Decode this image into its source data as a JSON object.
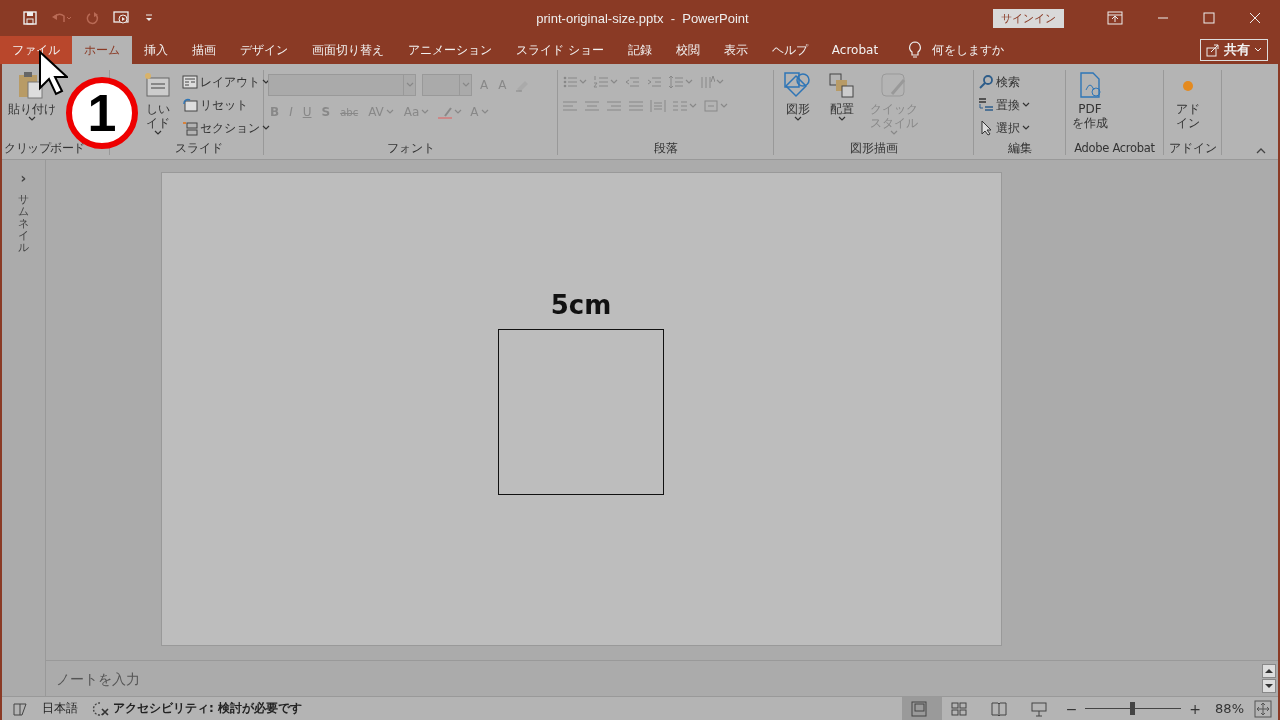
{
  "title_bar": {
    "title": "print-original-size.pptx  -  PowerPoint",
    "signin": "サインイン"
  },
  "tabs": [
    {
      "label": "ファイル",
      "kind": "file",
      "selected": false
    },
    {
      "label": "ホーム",
      "kind": "tab",
      "selected": true
    },
    {
      "label": "挿入",
      "kind": "tab",
      "selected": false
    },
    {
      "label": "描画",
      "kind": "tab",
      "selected": false
    },
    {
      "label": "デザイン",
      "kind": "tab",
      "selected": false
    },
    {
      "label": "画面切り替え",
      "kind": "tab",
      "selected": false
    },
    {
      "label": "アニメーション",
      "kind": "tab",
      "selected": false
    },
    {
      "label": "スライド ショー",
      "kind": "tab",
      "selected": false
    },
    {
      "label": "記録",
      "kind": "tab",
      "selected": false
    },
    {
      "label": "校閲",
      "kind": "tab",
      "selected": false
    },
    {
      "label": "表示",
      "kind": "tab",
      "selected": false
    },
    {
      "label": "ヘルプ",
      "kind": "tab",
      "selected": false
    },
    {
      "label": "Acrobat",
      "kind": "tab",
      "selected": false
    }
  ],
  "tell_me": "何をしますか",
  "share": "共有",
  "ribbon_groups": [
    {
      "label": "クリップボード",
      "kind": "columns",
      "disabled": false,
      "columns": [
        {
          "kind": "large",
          "lines": [
            "貼り付け"
          ],
          "caret": true,
          "disabled": false
        }
      ]
    },
    {
      "label": "スライド",
      "kind": "columns",
      "disabled": false,
      "columns": [
        {
          "kind": "large",
          "lines": [
            "しい",
            "イド"
          ],
          "caret": true,
          "disabled": false
        },
        {
          "kind": "stack",
          "items": [
            {
              "label": "レイアウト",
              "caret": true
            },
            {
              "label": "リセット",
              "caret": false
            },
            {
              "label": "セクション",
              "caret": true
            }
          ]
        }
      ]
    },
    {
      "label": "フォント",
      "kind": "rows",
      "disabled": true,
      "rows": [
        [
          {
            "kind": "font-field"
          },
          {
            "kind": "size-field"
          },
          {
            "kind": "glyph",
            "text": "A",
            "caret": false
          },
          {
            "kind": "glyph",
            "text": "A",
            "caret": false
          },
          {
            "kind": "icon",
            "caret": false
          }
        ],
        [
          {
            "kind": "glyph",
            "text": "B",
            "caret": false
          },
          {
            "kind": "glyph",
            "text": "I",
            "caret": false
          },
          {
            "kind": "glyph",
            "text": "U",
            "caret": false
          },
          {
            "kind": "glyph",
            "text": "S",
            "caret": false
          },
          {
            "kind": "glyph",
            "text": "abc",
            "caret": false
          },
          {
            "kind": "glyph",
            "text": "AV",
            "caret": true
          },
          {
            "kind": "glyph",
            "text": "Aa",
            "caret": true
          },
          {
            "kind": "icon",
            "caret": true
          },
          {
            "kind": "glyph",
            "text": "A",
            "caret": true
          }
        ]
      ]
    },
    {
      "label": "段落",
      "kind": "rows",
      "disabled": true,
      "rows": [
        [
          {
            "kind": "icon",
            "caret": true
          },
          {
            "kind": "icon",
            "caret": true
          },
          {
            "kind": "icon",
            "caret": false
          },
          {
            "kind": "icon",
            "caret": false
          },
          {
            "kind": "icon",
            "caret": true
          },
          {
            "kind": "icon",
            "caret": true
          }
        ],
        [
          {
            "kind": "icon",
            "caret": false
          },
          {
            "kind": "icon",
            "caret": false
          },
          {
            "kind": "icon",
            "caret": false
          },
          {
            "kind": "icon",
            "caret": false
          },
          {
            "kind": "icon",
            "caret": false
          },
          {
            "kind": "icon",
            "caret": true
          },
          {
            "kind": "icon",
            "caret": true
          }
        ]
      ]
    },
    {
      "label": "図形描画",
      "kind": "columns",
      "disabled": false,
      "columns": [
        {
          "kind": "large",
          "lines": [
            "図形"
          ],
          "caret": true,
          "disabled": false
        },
        {
          "kind": "large",
          "lines": [
            "配置"
          ],
          "caret": true,
          "disabled": false
        },
        {
          "kind": "large",
          "lines": [
            "クイック",
            "スタイル"
          ],
          "caret": true,
          "disabled": true
        }
      ]
    },
    {
      "label": "編集",
      "kind": "columns",
      "disabled": false,
      "columns": [
        {
          "kind": "stack",
          "items": [
            {
              "label": "検索",
              "caret": false
            },
            {
              "label": "置換",
              "caret": true
            },
            {
              "label": "選択",
              "caret": true
            }
          ]
        }
      ]
    },
    {
      "label": "Adobe Acrobat",
      "kind": "columns",
      "disabled": false,
      "columns": [
        {
          "kind": "large",
          "lines": [
            "PDF",
            "を作成"
          ],
          "caret": false,
          "disabled": false
        }
      ]
    },
    {
      "label": "アドイン",
      "kind": "columns",
      "disabled": false,
      "columns": [
        {
          "kind": "large",
          "lines": [
            "アド",
            "イン"
          ],
          "caret": false,
          "disabled": false
        }
      ]
    }
  ],
  "thumbnail_pane": {
    "toggle": "›",
    "label": "サムネイル"
  },
  "slide": {
    "label": "5cm"
  },
  "callout": {
    "text": "1"
  },
  "notes": {
    "placeholder": "ノートを入力"
  },
  "status_bar": {
    "language": "日本語",
    "accessibility": "アクセシビリティ: 検討が必要です",
    "views": [
      {
        "selected": true
      },
      {
        "selected": false
      },
      {
        "selected": false
      },
      {
        "selected": false
      }
    ],
    "zoom_out": "−",
    "zoom_in": "+",
    "zoom": {
      "level": 0.49
    },
    "zoom_text": "88%"
  }
}
